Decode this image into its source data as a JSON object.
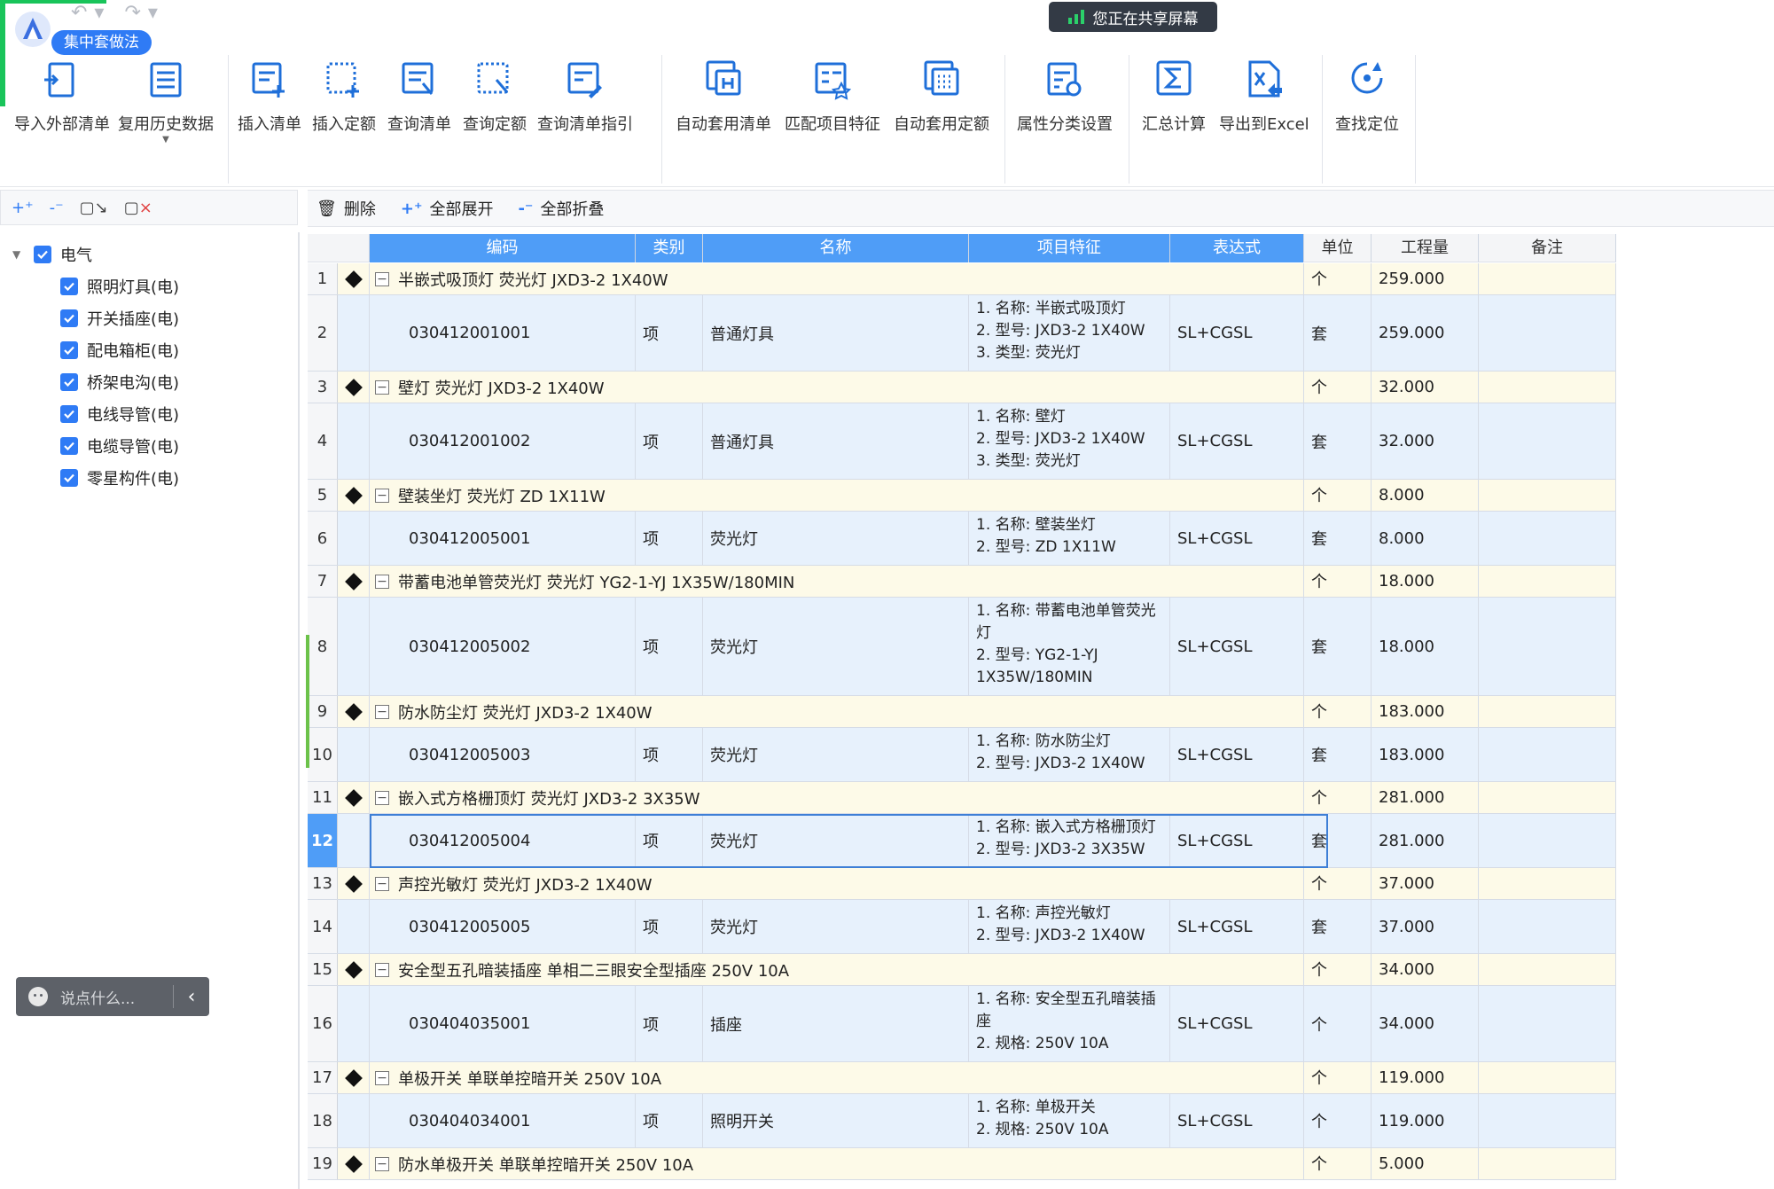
{
  "app": {
    "mode_label": "集中套做法",
    "share_banner": "您正在共享屏幕"
  },
  "toolbar": {
    "buttons": [
      {
        "label": "导入外部清单",
        "icon": "import-list-icon"
      },
      {
        "label": "复用历史数据",
        "icon": "reuse-history-icon"
      },
      {
        "label": "插入清单",
        "icon": "insert-list-icon"
      },
      {
        "label": "插入定额",
        "icon": "insert-quota-icon"
      },
      {
        "label": "查询清单",
        "icon": "query-list-icon"
      },
      {
        "label": "查询定额",
        "icon": "query-quota-icon"
      },
      {
        "label": "查询清单指引",
        "icon": "query-guide-icon"
      },
      {
        "label": "自动套用清单",
        "icon": "auto-apply-list-icon"
      },
      {
        "label": "匹配项目特征",
        "icon": "match-feature-icon"
      },
      {
        "label": "自动套用定额",
        "icon": "auto-apply-quota-icon"
      },
      {
        "label": "属性分类设置",
        "icon": "attribute-setting-icon"
      },
      {
        "label": "汇总计算",
        "icon": "sum-icon"
      },
      {
        "label": "导出到Excel",
        "icon": "excel-export-icon"
      },
      {
        "label": "查找定位",
        "icon": "locate-icon"
      }
    ]
  },
  "left": {
    "root": "电气",
    "items": [
      "照明灯具(电)",
      "开关插座(电)",
      "配电箱柜(电)",
      "桥架电沟(电)",
      "电线导管(电)",
      "电缆导管(电)",
      "零星构件(电)"
    ],
    "chat_placeholder": "说点什么..."
  },
  "table_toolbar": {
    "delete": "删除",
    "expand_all": "全部展开",
    "collapse_all": "全部折叠"
  },
  "table": {
    "headers": {
      "code": "编码",
      "type": "类别",
      "name": "名称",
      "feature": "项目特征",
      "expr": "表达式",
      "unit": "单位",
      "qty": "工程量",
      "remark": "备注"
    },
    "rows": [
      {
        "n": "1",
        "kind": "parent",
        "text": "半嵌式吸顶灯 荧光灯 JXD3-2 1X40W",
        "unit": "个",
        "qty": "259.000"
      },
      {
        "n": "2",
        "kind": "child",
        "code": "030412001001",
        "type": "项",
        "name": "普通灯具",
        "feature": [
          "1. 名称: 半嵌式吸顶灯",
          "2. 型号: JXD3-2 1X40W",
          "3. 类型: 荧光灯"
        ],
        "expr": "SL+CGSL",
        "unit": "套",
        "qty": "259.000"
      },
      {
        "n": "3",
        "kind": "parent",
        "text": "壁灯 荧光灯 JXD3-2 1X40W",
        "unit": "个",
        "qty": "32.000"
      },
      {
        "n": "4",
        "kind": "child",
        "code": "030412001002",
        "type": "项",
        "name": "普通灯具",
        "feature": [
          "1. 名称: 壁灯",
          "2. 型号: JXD3-2 1X40W",
          "3. 类型: 荧光灯"
        ],
        "expr": "SL+CGSL",
        "unit": "套",
        "qty": "32.000"
      },
      {
        "n": "5",
        "kind": "parent",
        "text": "壁装坐灯 荧光灯 ZD 1X11W",
        "unit": "个",
        "qty": "8.000"
      },
      {
        "n": "6",
        "kind": "child",
        "code": "030412005001",
        "type": "项",
        "name": "荧光灯",
        "feature": [
          "1. 名称: 壁装坐灯",
          "2. 型号: ZD 1X11W"
        ],
        "expr": "SL+CGSL",
        "unit": "套",
        "qty": "8.000"
      },
      {
        "n": "7",
        "kind": "parent",
        "text": "带蓄电池单管荧光灯 荧光灯 YG2-1-YJ 1X35W/180MIN",
        "unit": "个",
        "qty": "18.000"
      },
      {
        "n": "8",
        "kind": "child",
        "code": "030412005002",
        "type": "项",
        "name": "荧光灯",
        "feature": [
          "1. 名称: 带蓄电池单管荧光",
          "灯",
          "2. 型号: YG2-1-YJ",
          "1X35W/180MIN"
        ],
        "expr": "SL+CGSL",
        "unit": "套",
        "qty": "18.000"
      },
      {
        "n": "9",
        "kind": "parent",
        "text": "防水防尘灯 荧光灯 JXD3-2 1X40W",
        "unit": "个",
        "qty": "183.000"
      },
      {
        "n": "10",
        "kind": "child",
        "code": "030412005003",
        "type": "项",
        "name": "荧光灯",
        "feature": [
          "1. 名称: 防水防尘灯",
          "2. 型号: JXD3-2 1X40W"
        ],
        "expr": "SL+CGSL",
        "unit": "套",
        "qty": "183.000"
      },
      {
        "n": "11",
        "kind": "parent",
        "text": "嵌入式方格栅顶灯 荧光灯 JXD3-2 3X35W",
        "unit": "个",
        "qty": "281.000"
      },
      {
        "n": "12",
        "kind": "child",
        "selected": true,
        "code": "030412005004",
        "type": "项",
        "name": "荧光灯",
        "feature": [
          "1. 名称: 嵌入式方格栅顶灯",
          "2. 型号: JXD3-2 3X35W"
        ],
        "expr": "SL+CGSL",
        "unit": "套",
        "qty": "281.000"
      },
      {
        "n": "13",
        "kind": "parent",
        "text": "声控光敏灯 荧光灯 JXD3-2 1X40W",
        "unit": "个",
        "qty": "37.000"
      },
      {
        "n": "14",
        "kind": "child",
        "code": "030412005005",
        "type": "项",
        "name": "荧光灯",
        "feature": [
          "1. 名称: 声控光敏灯",
          "2. 型号: JXD3-2 1X40W"
        ],
        "expr": "SL+CGSL",
        "unit": "套",
        "qty": "37.000"
      },
      {
        "n": "15",
        "kind": "parent",
        "text": "安全型五孔暗装插座 单相二三眼安全型插座 250V 10A",
        "unit": "个",
        "qty": "34.000"
      },
      {
        "n": "16",
        "kind": "child",
        "code": "030404035001",
        "type": "项",
        "name": "插座",
        "feature": [
          "1. 名称: 安全型五孔暗装插",
          "座",
          "2. 规格: 250V 10A"
        ],
        "expr": "SL+CGSL",
        "unit": "个",
        "qty": "34.000"
      },
      {
        "n": "17",
        "kind": "parent",
        "text": "单极开关 单联单控暗开关 250V 10A",
        "unit": "个",
        "qty": "119.000"
      },
      {
        "n": "18",
        "kind": "child",
        "code": "030404034001",
        "type": "项",
        "name": "照明开关",
        "feature": [
          "1. 名称: 单极开关",
          "2. 规格: 250V 10A"
        ],
        "expr": "SL+CGSL",
        "unit": "个",
        "qty": "119.000"
      },
      {
        "n": "19",
        "kind": "parent",
        "text": "防水单极开关 单联单控暗开关 250V 10A",
        "unit": "个",
        "qty": "5.000"
      }
    ]
  },
  "colors": {
    "accent": "#2f7bf5",
    "header_blue": "#4f9df7",
    "parent_row": "#fdfae8",
    "child_row": "#e7f1fc"
  }
}
